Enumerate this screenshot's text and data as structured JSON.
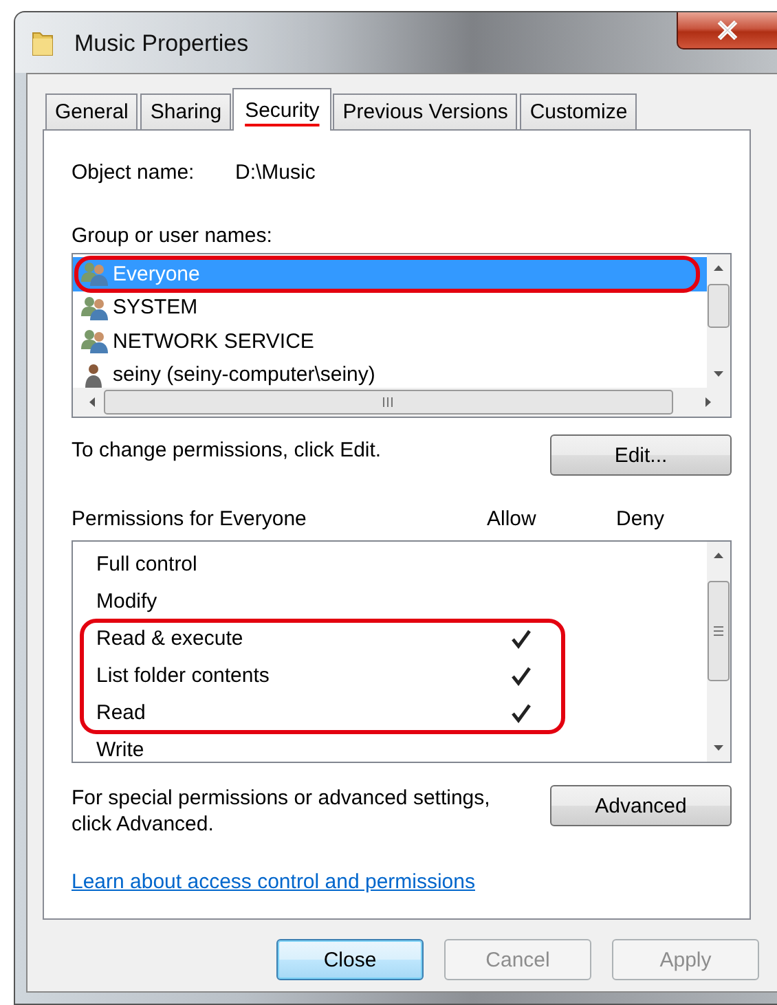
{
  "window": {
    "title": "Music Properties"
  },
  "tabs": [
    {
      "label": "General",
      "selected": false,
      "marked": false
    },
    {
      "label": "Sharing",
      "selected": false,
      "marked": false
    },
    {
      "label": "Security",
      "selected": true,
      "marked": true
    },
    {
      "label": "Previous Versions",
      "selected": false,
      "marked": false
    },
    {
      "label": "Customize",
      "selected": false,
      "marked": false
    }
  ],
  "object_name": {
    "label": "Object name:",
    "value": "D:\\Music"
  },
  "users": {
    "label": "Group or user names:",
    "items": [
      {
        "name": "Everyone",
        "kind": "group",
        "selected": true,
        "circled": true
      },
      {
        "name": "SYSTEM",
        "kind": "group",
        "selected": false,
        "circled": false
      },
      {
        "name": "NETWORK SERVICE",
        "kind": "group",
        "selected": false,
        "circled": false
      },
      {
        "name": "seiny (seiny-computer\\seiny)",
        "kind": "user",
        "selected": false,
        "circled": false
      }
    ]
  },
  "edit_hint": "To change permissions, click Edit.",
  "edit_button": "Edit...",
  "permissions": {
    "label": "Permissions for Everyone",
    "columns": [
      "Allow",
      "Deny"
    ],
    "items": [
      {
        "name": "Full control",
        "allow": false,
        "deny": false,
        "circled": false
      },
      {
        "name": "Modify",
        "allow": false,
        "deny": false,
        "circled": false
      },
      {
        "name": "Read & execute",
        "allow": true,
        "deny": false,
        "circled": true
      },
      {
        "name": "List folder contents",
        "allow": true,
        "deny": false,
        "circled": true
      },
      {
        "name": "Read",
        "allow": true,
        "deny": false,
        "circled": true
      },
      {
        "name": "Write",
        "allow": false,
        "deny": false,
        "circled": false
      }
    ]
  },
  "advanced_hint": "For special permissions or advanced settings, click Advanced.",
  "advanced_button": "Advanced",
  "link": "Learn about access control and permissions",
  "buttons": [
    {
      "label": "Close",
      "default": true,
      "disabled": false
    },
    {
      "label": "Cancel",
      "default": false,
      "disabled": true
    },
    {
      "label": "Apply",
      "default": false,
      "disabled": true
    }
  ]
}
